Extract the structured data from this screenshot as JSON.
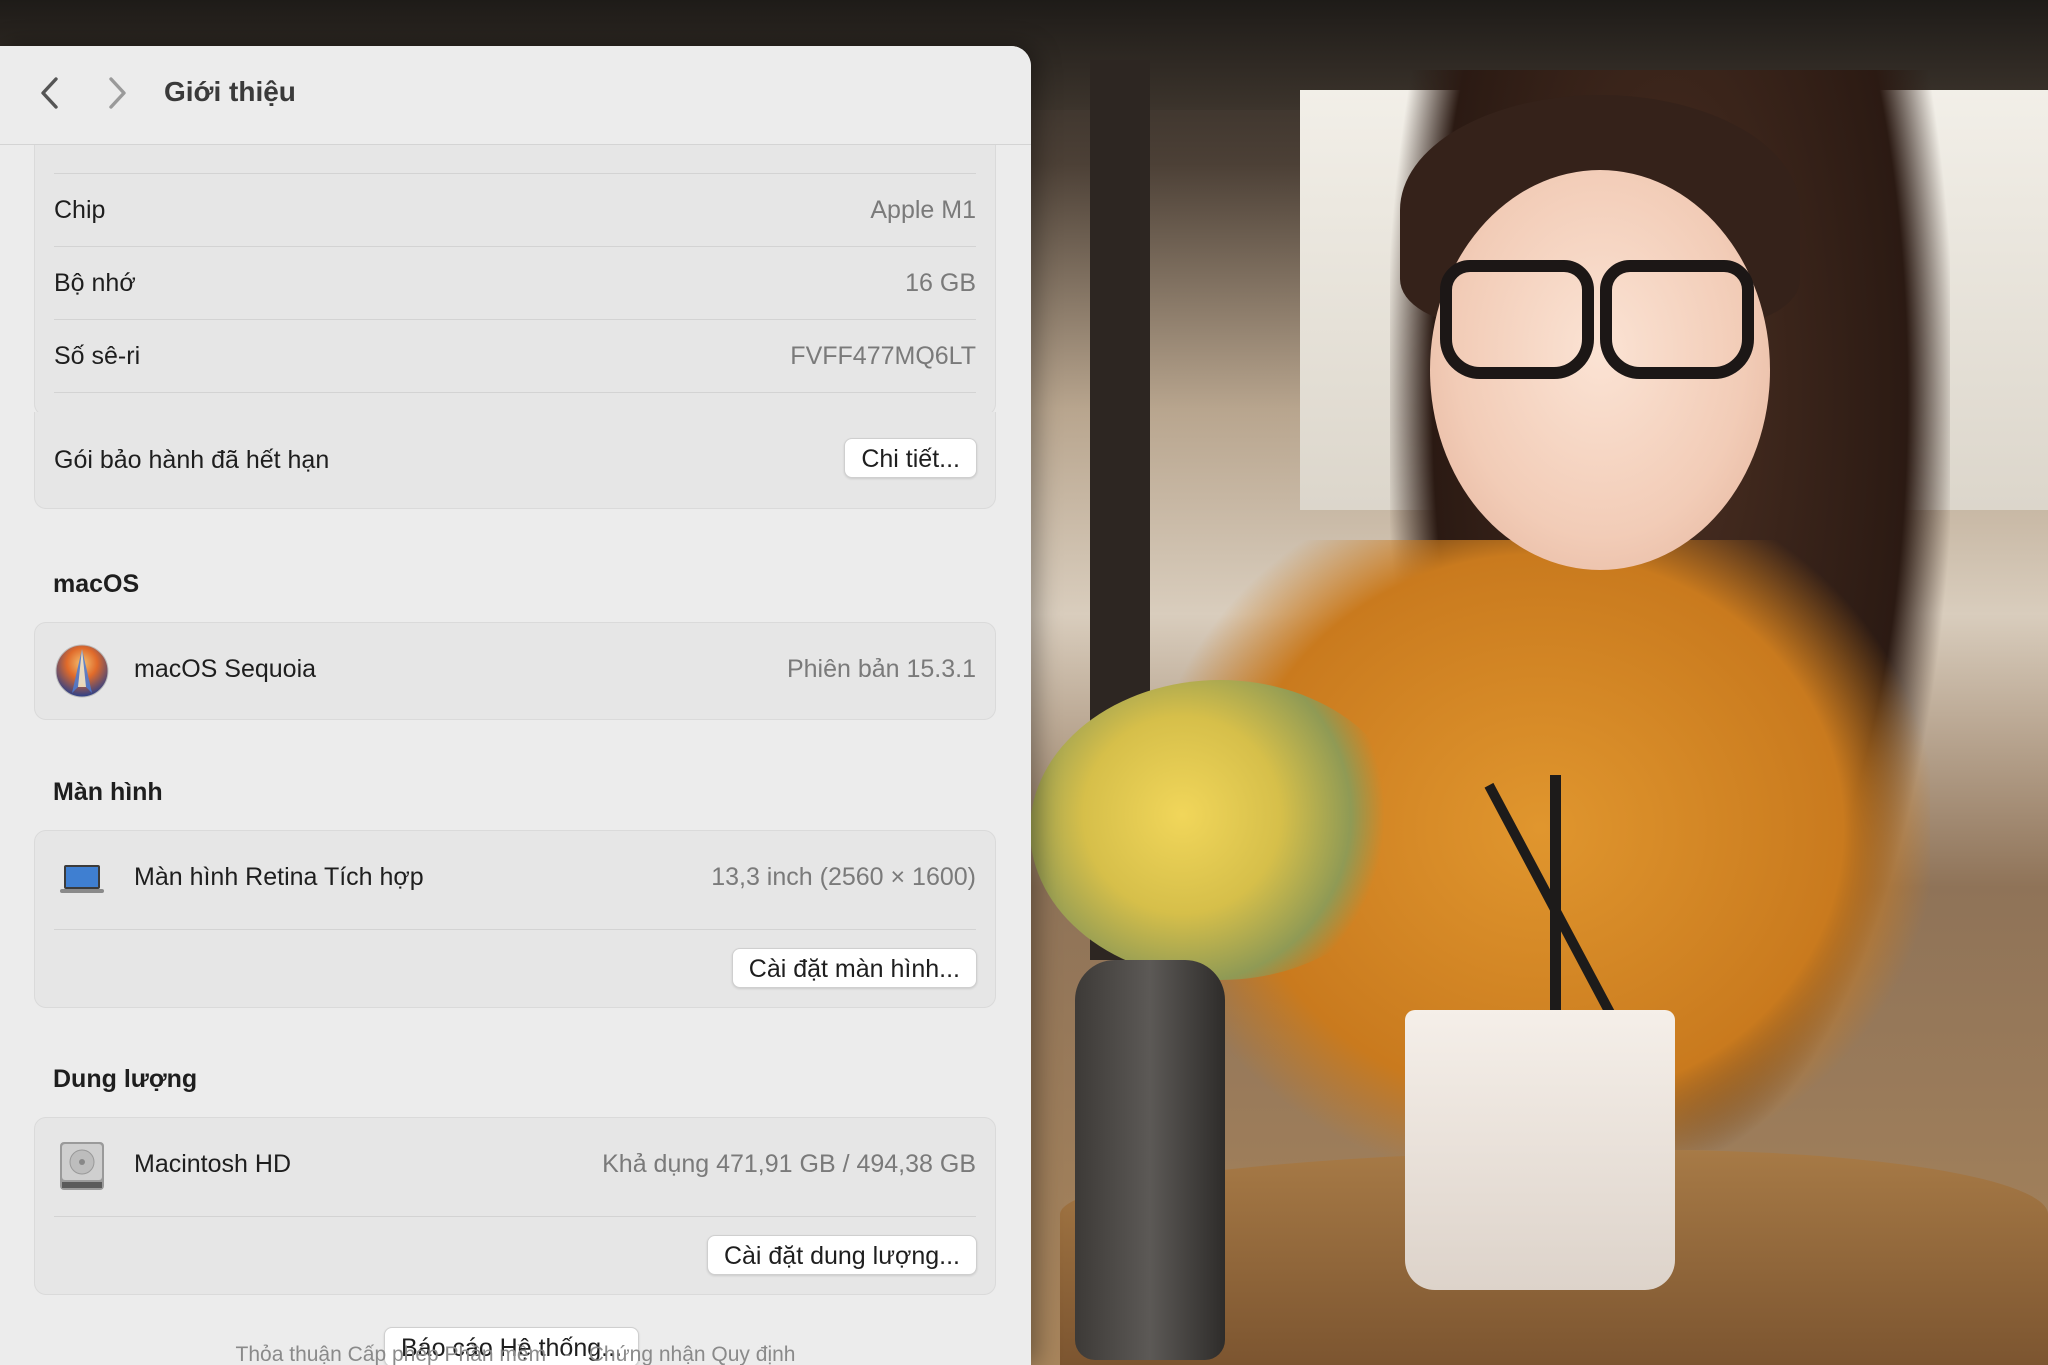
{
  "window": {
    "title": "Giới thiệu"
  },
  "nav": {
    "back_icon": "chevron-left-icon",
    "forward_icon": "chevron-right-icon"
  },
  "hardware": {
    "chip": {
      "label": "Chip",
      "value": "Apple M1"
    },
    "memory": {
      "label": "Bộ nhớ",
      "value": "16 GB"
    },
    "serial": {
      "label": "Số sê-ri",
      "value": "FVFF477MQ6LT"
    },
    "warranty": {
      "label": "Gói bảo hành đã hết hạn",
      "button": "Chi tiết..."
    }
  },
  "macos": {
    "section_title": "macOS",
    "name": "macOS Sequoia",
    "version": "Phiên bản 15.3.1",
    "icon": "macos-sequoia-icon"
  },
  "display": {
    "section_title": "Màn hình",
    "name": "Màn hình Retina Tích hợp",
    "spec": "13,3 inch (2560 × 1600)",
    "button": "Cài đặt màn hình...",
    "icon": "laptop-icon"
  },
  "storage": {
    "section_title": "Dung lượng",
    "name": "Macintosh HD",
    "spec": "Khả dụng 471,91 GB / 494,38 GB",
    "button": "Cài đặt dung lượng...",
    "icon": "hard-drive-icon"
  },
  "system_report": {
    "button": "Báo cáo Hệ thống..."
  },
  "footer": {
    "license": "Thỏa thuận Cấp phép Phần mềm",
    "separator": "-",
    "regulatory": "Chứng nhận Quy định"
  },
  "colors": {
    "window_bg": "#ececec",
    "card_bg": "#e6e6e6",
    "secondary_text": "#7a7a7a"
  }
}
